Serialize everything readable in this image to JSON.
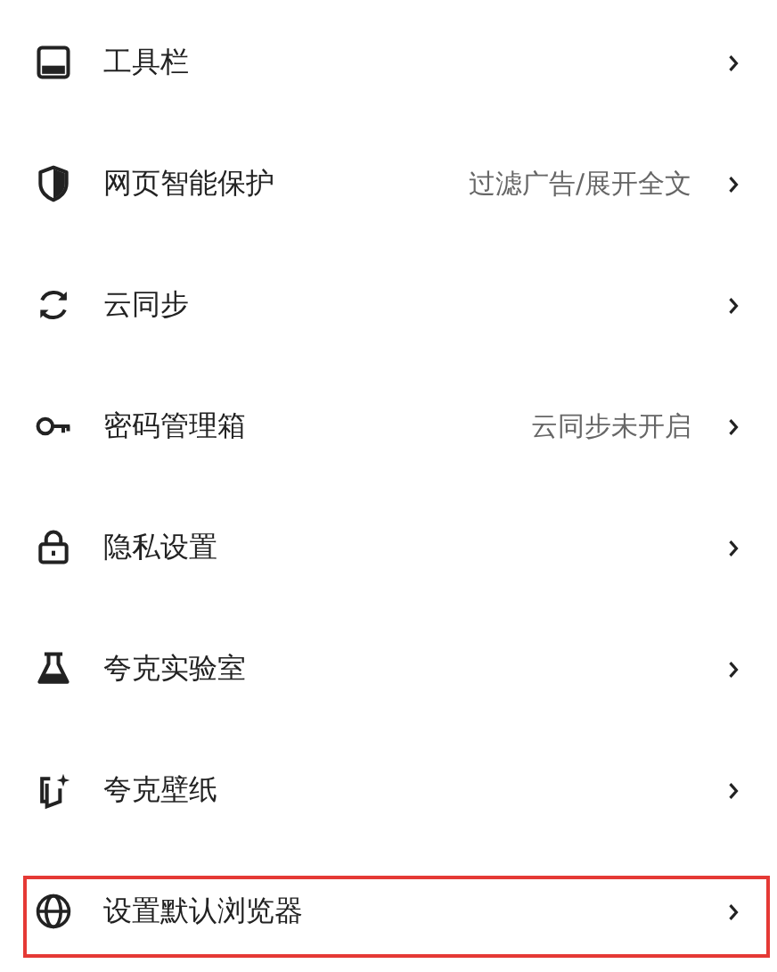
{
  "settings": [
    {
      "label": "工具栏",
      "highlighted": false
    },
    {
      "label": "网页智能保护",
      "value": "过滤广告/展开全文",
      "highlighted": false
    },
    {
      "label": "云同步",
      "highlighted": false
    },
    {
      "label": "密码管理箱",
      "value": "云同步未开启",
      "highlighted": false
    },
    {
      "label": "隐私设置",
      "highlighted": false
    },
    {
      "label": "夸克实验室",
      "highlighted": false
    },
    {
      "label": "夸克壁纸",
      "highlighted": false
    },
    {
      "label": "设置默认浏览器",
      "highlighted": true
    }
  ]
}
